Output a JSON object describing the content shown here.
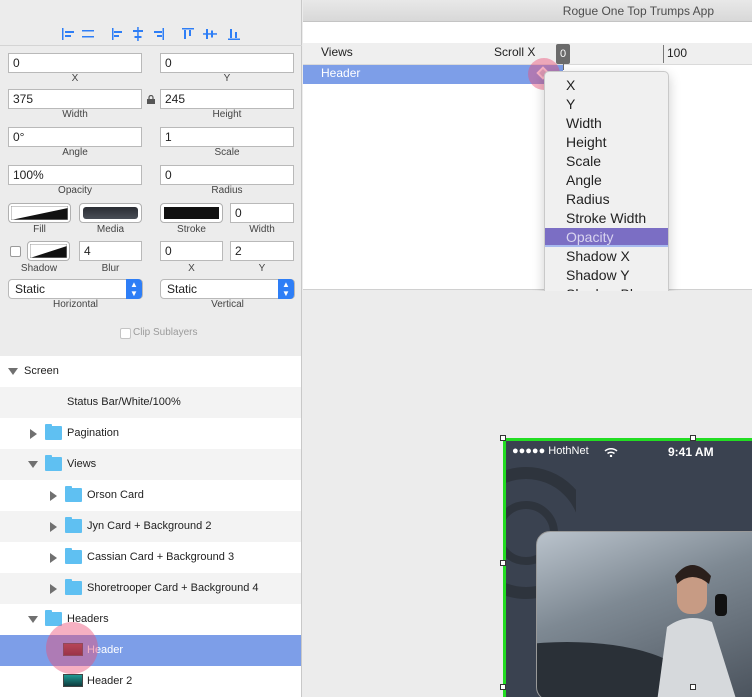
{
  "window": {
    "title": "Rogue One Top Trumps App"
  },
  "inspector": {
    "x": {
      "value": "0",
      "label": "X"
    },
    "y": {
      "value": "0",
      "label": "Y"
    },
    "width": {
      "value": "375",
      "label": "Width"
    },
    "height": {
      "value": "245",
      "label": "Height"
    },
    "angle": {
      "value": "0°",
      "label": "Angle"
    },
    "scale": {
      "value": "1",
      "label": "Scale"
    },
    "opacity": {
      "value": "100%",
      "label": "Opacity"
    },
    "radius": {
      "value": "0",
      "label": "Radius"
    },
    "fill_label": "Fill",
    "media_label": "Media",
    "stroke_label": "Stroke",
    "stroke_width": {
      "value": "0",
      "label": "Width"
    },
    "shadow_label": "Shadow",
    "blur": {
      "value": "4",
      "label": "Blur"
    },
    "shadow_x": {
      "value": "0",
      "label": "X"
    },
    "shadow_y": {
      "value": "2",
      "label": "Y"
    },
    "horizontal": {
      "value": "Static",
      "label": "Horizontal"
    },
    "vertical": {
      "value": "Static",
      "label": "Vertical"
    },
    "clip_sublayers": "Clip Sublayers"
  },
  "layers": [
    {
      "label": "Screen"
    },
    {
      "label": "Status Bar/White/100%"
    },
    {
      "label": "Pagination"
    },
    {
      "label": "Views"
    },
    {
      "label": "Orson Card"
    },
    {
      "label": "Jyn Card + Background 2"
    },
    {
      "label": "Cassian Card + Background 3"
    },
    {
      "label": "Shoretrooper Card + Background 4"
    },
    {
      "label": "Headers"
    },
    {
      "label": "Header"
    },
    {
      "label": "Header 2"
    }
  ],
  "timeline": {
    "views_label": "Views",
    "scroll_label": "Scroll X",
    "row_label": "Header",
    "playhead": "0",
    "ruler_mark": "100"
  },
  "property_menu": {
    "items": [
      "X",
      "Y",
      "Width",
      "Height",
      "Scale",
      "Angle",
      "Radius",
      "Stroke Width",
      "Opacity",
      "Shadow X",
      "Shadow Y",
      "Shadow Blur"
    ],
    "highlighted": "Opacity"
  },
  "preview": {
    "carrier": "●●●●● HothNet",
    "time": "9:41 AM"
  },
  "colors": {
    "selection": "#7d9ee8",
    "highlight": "#7b6ec4",
    "folder": "#5fc0f2",
    "selection_outline": "#22dd22"
  }
}
